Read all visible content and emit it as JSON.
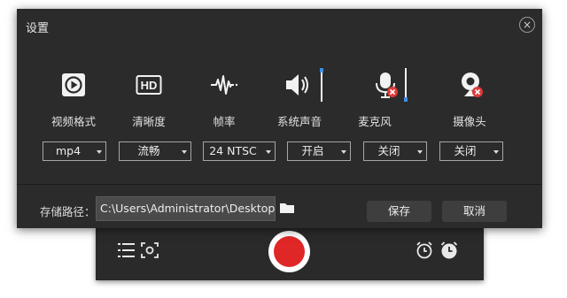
{
  "dialog": {
    "title": "设置",
    "close_glyph": "×",
    "settings": [
      {
        "label": "视频格式",
        "icon": "video-format-icon",
        "value": "mp4"
      },
      {
        "label": "清晰度",
        "icon": "hd-icon",
        "value": "流畅"
      },
      {
        "label": "帧率",
        "icon": "frame-rate-icon",
        "value": "24 NTSC"
      },
      {
        "label": "系统声音",
        "icon": "speaker-icon",
        "value": "开启",
        "volume_level": 1.0
      },
      {
        "label": "麦克风",
        "icon": "microphone-muted-icon",
        "value": "关闭",
        "volume_level": 0.0
      },
      {
        "label": "摄像头",
        "icon": "webcam-off-icon",
        "value": "关闭"
      }
    ],
    "path_label": "存储路径：",
    "path_value": "C:\\Users\\Administrator\\Desktop\\",
    "folder_icon": "folder-icon",
    "save_label": "保存",
    "cancel_label": "取消"
  },
  "recorder_bar": {
    "icons": [
      "list-icon",
      "screenshot-icon",
      "record-icon",
      "alarm-clock-icon",
      "timer-clock-icon"
    ]
  },
  "colors": {
    "dialog_bg": "#2b2b2b",
    "accent_blue": "#3d8fe0",
    "record_red": "#e02727",
    "mute_red": "#e03a3a"
  }
}
